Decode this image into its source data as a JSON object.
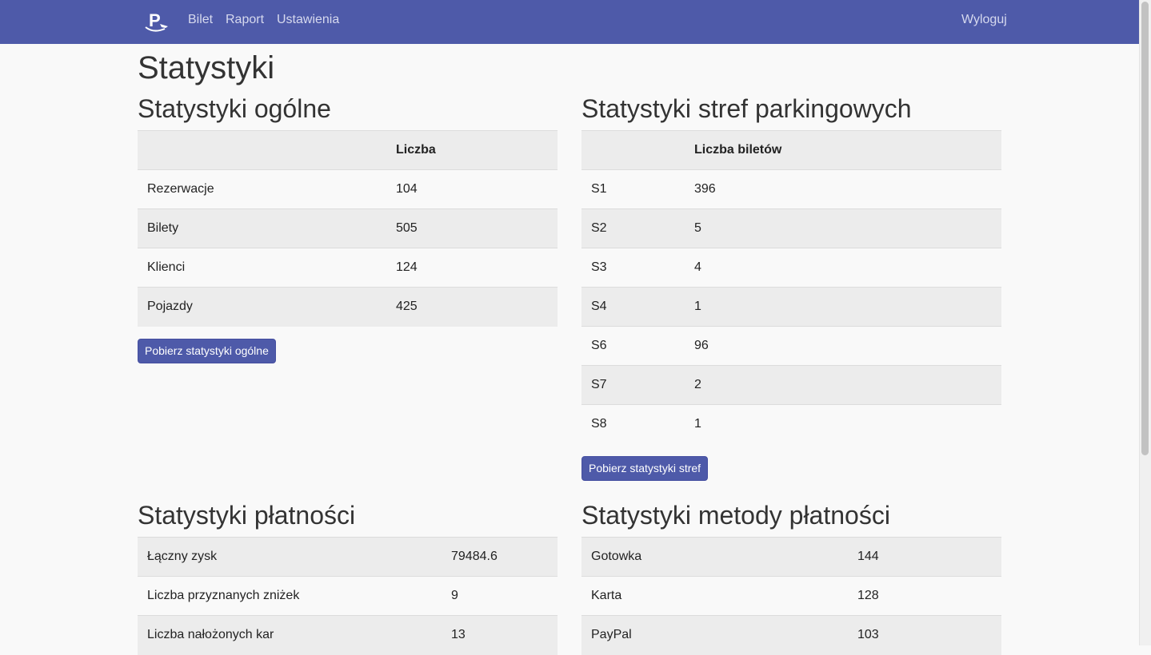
{
  "nav": {
    "brand_letter": "P",
    "links": [
      "Bilet",
      "Raport",
      "Ustawienia"
    ],
    "logout": "Wyloguj"
  },
  "page_title": "Statystyki",
  "general": {
    "title": "Statystyki ogólne",
    "header": [
      "",
      "Liczba"
    ],
    "rows": [
      [
        "Rezerwacje",
        "104"
      ],
      [
        "Bilety",
        "505"
      ],
      [
        "Klienci",
        "124"
      ],
      [
        "Pojazdy",
        "425"
      ]
    ],
    "button": "Pobierz statystyki ogólne"
  },
  "zones": {
    "title": "Statystyki stref parkingowych",
    "header": [
      "",
      "Liczba biletów"
    ],
    "rows": [
      [
        "S1",
        "396"
      ],
      [
        "S2",
        "5"
      ],
      [
        "S3",
        "4"
      ],
      [
        "S4",
        "1"
      ],
      [
        "S6",
        "96"
      ],
      [
        "S7",
        "2"
      ],
      [
        "S8",
        "1"
      ]
    ],
    "button": "Pobierz statystyki stref"
  },
  "payments": {
    "title": "Statystyki płatności",
    "rows": [
      [
        "Łączny zysk",
        "79484.6"
      ],
      [
        "Liczba przyznanych zniżek",
        "9"
      ],
      [
        "Liczba nałożonych kar",
        "13"
      ]
    ]
  },
  "payment_methods": {
    "title": "Statystyki metody płatności",
    "rows": [
      [
        "Gotowka",
        "144"
      ],
      [
        "Karta",
        "128"
      ],
      [
        "PayPal",
        "103"
      ]
    ]
  },
  "colors": {
    "navbar": "#4e5aa9",
    "button": "#4e5aa9",
    "row_shade": "#ececec"
  }
}
